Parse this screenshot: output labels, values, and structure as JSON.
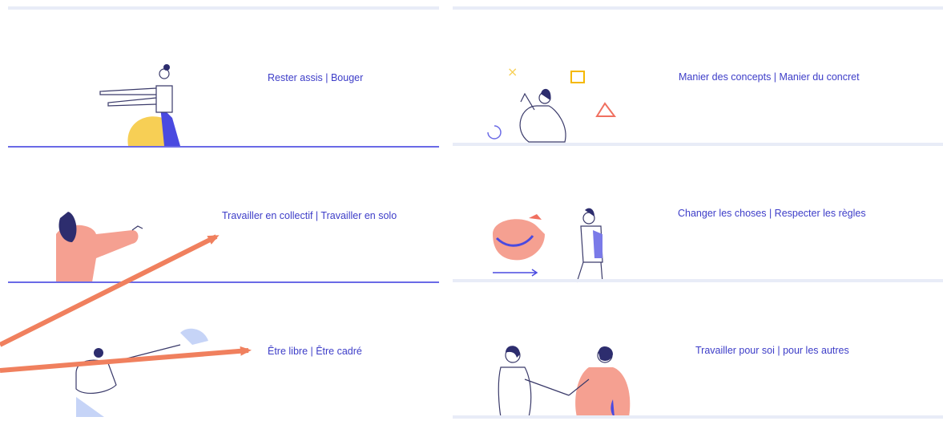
{
  "cards": [
    {
      "id": "sit-move",
      "label": "Rester assis | Bouger"
    },
    {
      "id": "concepts-concrete",
      "label": "Manier des concepts | Manier du concret"
    },
    {
      "id": "collective-solo",
      "label": "Travailler en collectif | Travailler en solo"
    },
    {
      "id": "change-rules",
      "label": "Changer les choses | Respecter les règles"
    },
    {
      "id": "free-framed",
      "label": "Être libre | Être cadré"
    },
    {
      "id": "self-others",
      "label": "Travailler pour soi | pour les autres"
    }
  ],
  "colors": {
    "label": "#3d3dc8",
    "divider_blue": "#6a6ae6",
    "divider_light": "#e8ecf7",
    "arrow": "#f0805e",
    "accent_yellow": "#f7cf55",
    "accent_pink": "#f5a091",
    "accent_blue": "#4a4ae0"
  },
  "icons": [
    "person-pointing-illustration",
    "person-thinking-illustration",
    "person-gesturing-illustration",
    "person-with-bird-illustration",
    "person-with-bird-flying-illustration",
    "handshake-illustration",
    "annotation-arrow"
  ]
}
